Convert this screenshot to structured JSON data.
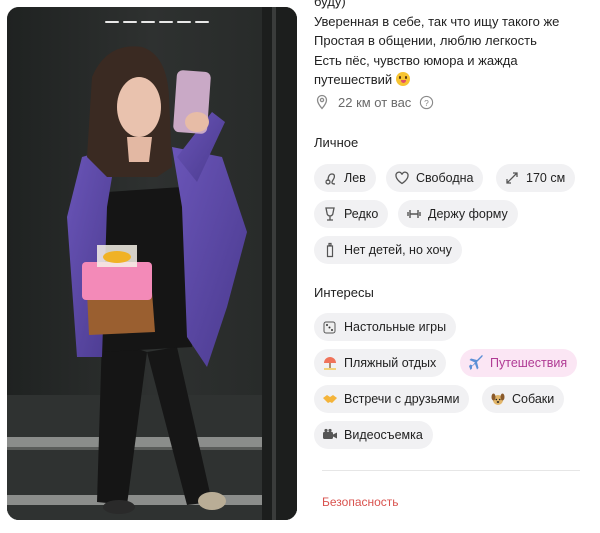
{
  "photo": {
    "pages": 6
  },
  "bio": {
    "line0": "буду)",
    "line1": "Уверенная в себе, так что ищу такого же",
    "line2": "Простая в общении, люблю легкость",
    "line3": "Есть пёс, чувство юмора и жажда",
    "line4": "путешествий"
  },
  "distance": {
    "text": "22 км от вас"
  },
  "personal": {
    "title": "Личное",
    "chips": [
      "Лев",
      "Свободна",
      "170 см",
      "Редко",
      "Держу форму",
      "Нет детей, но хочу"
    ]
  },
  "interests": {
    "title": "Интересы",
    "chips": [
      "Настольные игры",
      "Пляжный отдых",
      "Путешествия",
      "Встречи с друзьями",
      "Собаки",
      "Видеосъемка"
    ],
    "active": "Путешествия"
  },
  "footer": {
    "security": "Безопасность"
  },
  "colors": {
    "chip_bg": "#f1f1f3",
    "active_bg": "#fbe6f4",
    "active_text": "#b03a94",
    "link": "#d9534f"
  }
}
